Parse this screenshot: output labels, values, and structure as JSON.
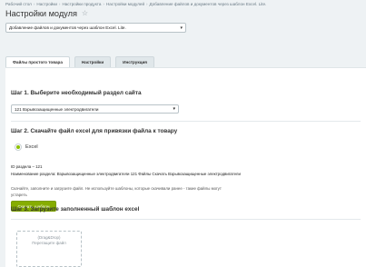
{
  "breadcrumb": {
    "items": [
      "Рабочий стол",
      "Настройки",
      "Настройки продукта",
      "Настройки модулей",
      "Добавление файлов и документов через шаблон Excel. Lite."
    ]
  },
  "header": {
    "title": "Настройки модуля",
    "star_icon": "star-icon"
  },
  "module_select": {
    "value": "Добавление файлов и документов через шаблон Excel. Lite."
  },
  "tabs": [
    {
      "label": "Файлы простого товара",
      "active": true
    },
    {
      "label": "Настройки",
      "active": false
    },
    {
      "label": "Инструкция",
      "active": false
    }
  ],
  "step1": {
    "title": "Шаг 1. Выберите необходимый раздел сайта",
    "select_value": "121 Взрывозащищенные электродвигатели"
  },
  "step2": {
    "title": "Шаг 2. Скачайте файл excel для привязки файла к товару",
    "radio_label": "Excel",
    "section_id": "ID раздела – 121",
    "section_name": "Наименование раздела: Взрывозащищенные электродвигатели 121 Файлы Скачать Взрывозащищенные электродвигатели",
    "hint": "Скачайте, заполните и загрузите файл. Не используйте шаблоны, которые скачивали ранее - такие файлы могут устареть",
    "download_label": "Скачать шаблон"
  },
  "step3": {
    "title": "Шаг 3. Загрузите заполненный шаблон excel",
    "dropzone_line1": "(Drag&Drop)",
    "dropzone_line2": "Перетащите файл"
  },
  "colors": {
    "accent": "#86ad00",
    "radio": "#8dc100",
    "background": "#eef2f4"
  }
}
